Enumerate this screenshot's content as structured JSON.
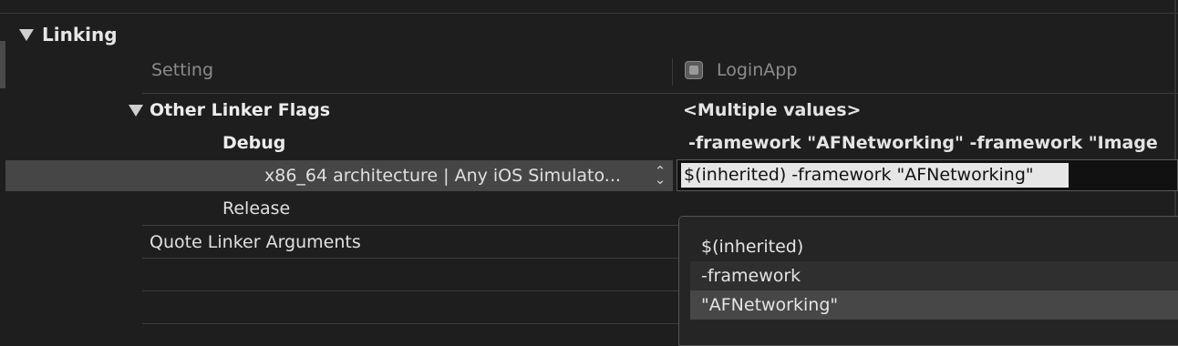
{
  "section": {
    "title": "Linking"
  },
  "header": {
    "setting_label": "Setting",
    "target_name": "LoginApp"
  },
  "rows": {
    "other_linker_flags": {
      "label": "Other Linker Flags",
      "value": "<Multiple values>"
    },
    "debug": {
      "label": "Debug",
      "value": "-framework \"AFNetworking\" -framework \"Image"
    },
    "arch": {
      "label": "x86_64 architecture | Any iOS Simulato...",
      "value": "$(inherited) -framework \"AFNetworking\""
    },
    "release": {
      "label": "Release"
    },
    "quote_linker": {
      "label": "Quote Linker Arguments"
    }
  },
  "popup": {
    "items": [
      "$(inherited)",
      "-framework",
      "\"AFNetworking\""
    ],
    "selected_index": 2
  },
  "icons": {
    "disclosure": "disclosure-triangle-down-icon",
    "target": "app-target-icon",
    "stepper": "up-down-chevron-icon"
  },
  "colors": {
    "background": "#1e1e1e",
    "selected_row": "#464646",
    "text_highlight": "#e6e6e6"
  }
}
